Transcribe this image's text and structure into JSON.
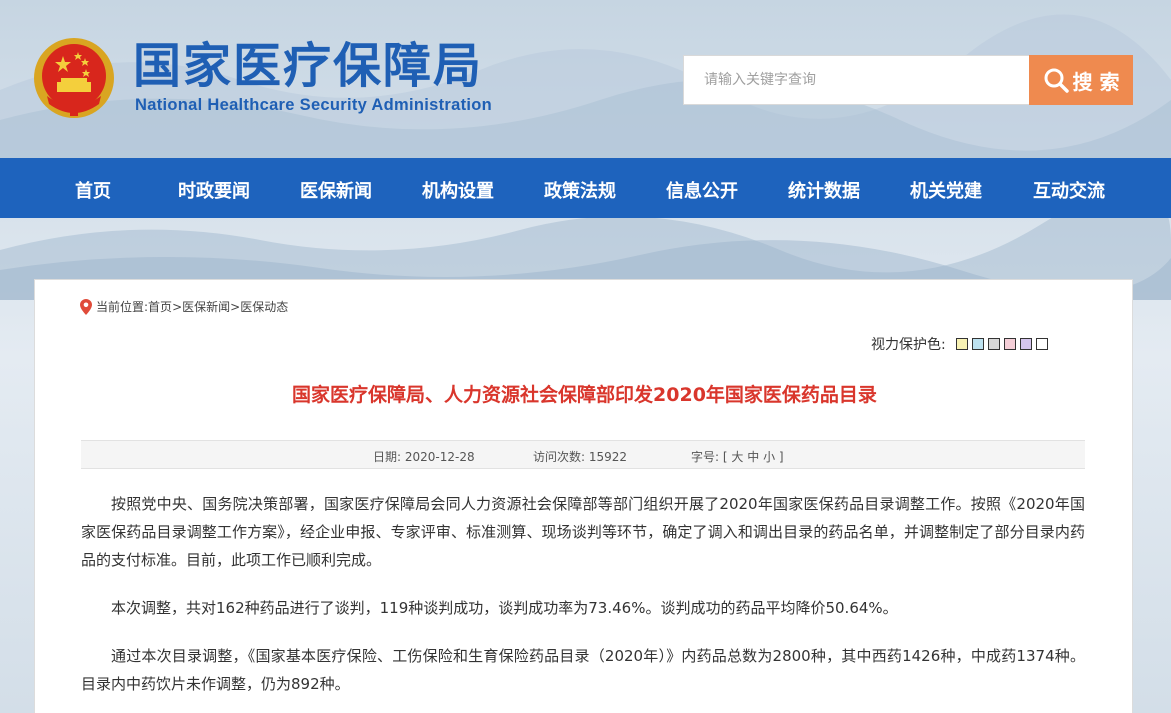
{
  "header": {
    "title": "国家医疗保障局",
    "subtitle": "National Healthcare Security Administration",
    "search": {
      "placeholder": "请输入关键字查询",
      "button_label": "搜 索"
    }
  },
  "nav": {
    "items": [
      {
        "label": "首页"
      },
      {
        "label": "时政要闻"
      },
      {
        "label": "医保新闻"
      },
      {
        "label": "机构设置"
      },
      {
        "label": "政策法规"
      },
      {
        "label": "信息公开"
      },
      {
        "label": "统计数据"
      },
      {
        "label": "机关党建"
      },
      {
        "label": "互动交流"
      }
    ]
  },
  "breadcrumb": {
    "prefix": "当前位置:",
    "items": [
      "首页",
      "医保新闻",
      "医保动态"
    ],
    "separator": ">"
  },
  "eye_care": {
    "label": "视力保护色:",
    "swatches": [
      "#f8f2b4",
      "#bde2f0",
      "#d8d8d8",
      "#f5cfd8",
      "#d5c5ee",
      "#ffffff"
    ]
  },
  "article": {
    "title": "国家医疗保障局、人力资源社会保障部印发2020年国家医保药品目录",
    "meta": {
      "date_label": "日期:",
      "date": "2020-12-28",
      "views_label": "访问次数:",
      "views": "15922",
      "font_label": "字号:",
      "font_open": "[",
      "font_sizes": [
        "大",
        "中",
        "小"
      ],
      "font_close": "]"
    },
    "paragraphs": [
      "按照党中央、国务院决策部署，国家医疗保障局会同人力资源社会保障部等部门组织开展了2020年国家医保药品目录调整工作。按照《2020年国家医保药品目录调整工作方案》，经企业申报、专家评审、标准测算、现场谈判等环节，确定了调入和调出目录的药品名单，并调整制定了部分目录内药品的支付标准。目前，此项工作已顺利完成。",
      "本次调整，共对162种药品进行了谈判，119种谈判成功，谈判成功率为73.46%。谈判成功的药品平均降价50.64%。",
      "通过本次目录调整，《国家基本医疗保险、工伤保险和生育保险药品目录（2020年）》内药品总数为2800种，其中西药1426种，中成药1374种。目录内中药饮片未作调整，仍为892种。"
    ]
  },
  "colors": {
    "brand_blue": "#1e63bd",
    "title_red": "#d9362c",
    "search_orange": "#ef8a4f"
  }
}
